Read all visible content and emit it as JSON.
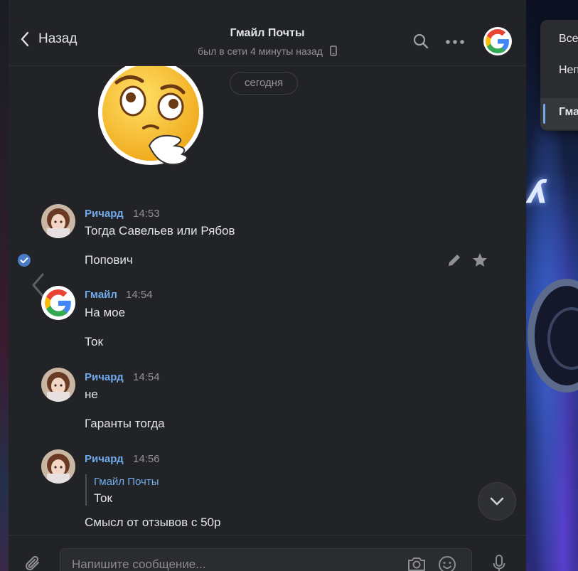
{
  "header": {
    "back_label": "Назад",
    "title": "Гмайл Почты",
    "subtitle": "был в сети 4 минуты назад"
  },
  "date_separator": "сегодня",
  "messages": [
    {
      "author": "Ричард",
      "time": "14:53",
      "texts": [
        "Тогда Савельев или Рябов",
        "Попович"
      ],
      "avatar": "anime-girl-avatar"
    },
    {
      "author": "Гмайл",
      "time": "14:54",
      "texts": [
        "На мое",
        "Ток"
      ],
      "avatar": "google-avatar"
    },
    {
      "author": "Ричард",
      "time": "14:54",
      "texts": [
        "не",
        "Гаранты тогда"
      ],
      "avatar": "anime-girl-avatar"
    },
    {
      "author": "Ричард",
      "time": "14:56",
      "reply": {
        "author": "Гмайл Почты",
        "text": "Ток"
      },
      "texts": [
        "Смысл от отзывов с 50р"
      ],
      "avatar": "anime-girl-avatar"
    }
  ],
  "composer": {
    "placeholder": "Напишите сообщение..."
  },
  "popup": {
    "items": [
      "Все",
      "Неп",
      "Гма"
    ]
  },
  "colors": {
    "panel": "#222327",
    "accent": "#71aaeb",
    "text": "#e1e3e6",
    "muted": "#939393"
  }
}
